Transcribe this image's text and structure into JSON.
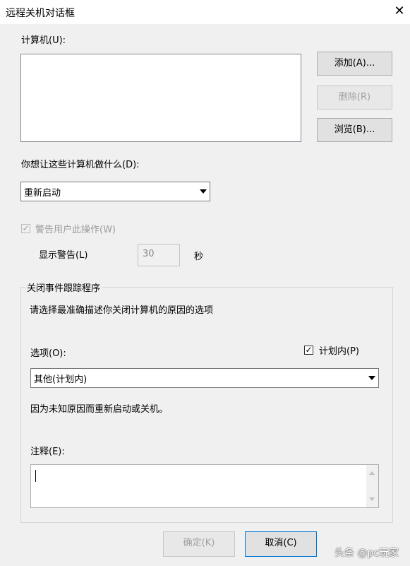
{
  "window": {
    "title": "远程关机对话框",
    "close_glyph": "✕"
  },
  "computers": {
    "label": "计算机(U):",
    "items": []
  },
  "buttons": {
    "add": "添加(A)...",
    "remove": "删除(R)",
    "browse": "浏览(B)...",
    "ok": "确定(K)",
    "cancel": "取消(C)"
  },
  "action": {
    "label": "你想让这些计算机做什么(D):",
    "selected": "重新启动"
  },
  "warn": {
    "checkbox_label": "警告用户此操作(W)",
    "checked": true,
    "display_label": "显示警告(L)",
    "seconds_value": "30",
    "seconds_unit": "秒"
  },
  "tracker": {
    "group_label": "关闭事件跟踪程序",
    "instruction": "请选择最准确描述你关闭计算机的原因的选项",
    "option_label": "选项(O):",
    "planned_label": "计划内(P)",
    "planned_checked": true,
    "selected_option": "其他(计划内)",
    "description": "因为未知原因而重新启动或关机。",
    "comment_label": "注释(E):",
    "comment_value": ""
  },
  "watermark": "头条 @pc玩家"
}
